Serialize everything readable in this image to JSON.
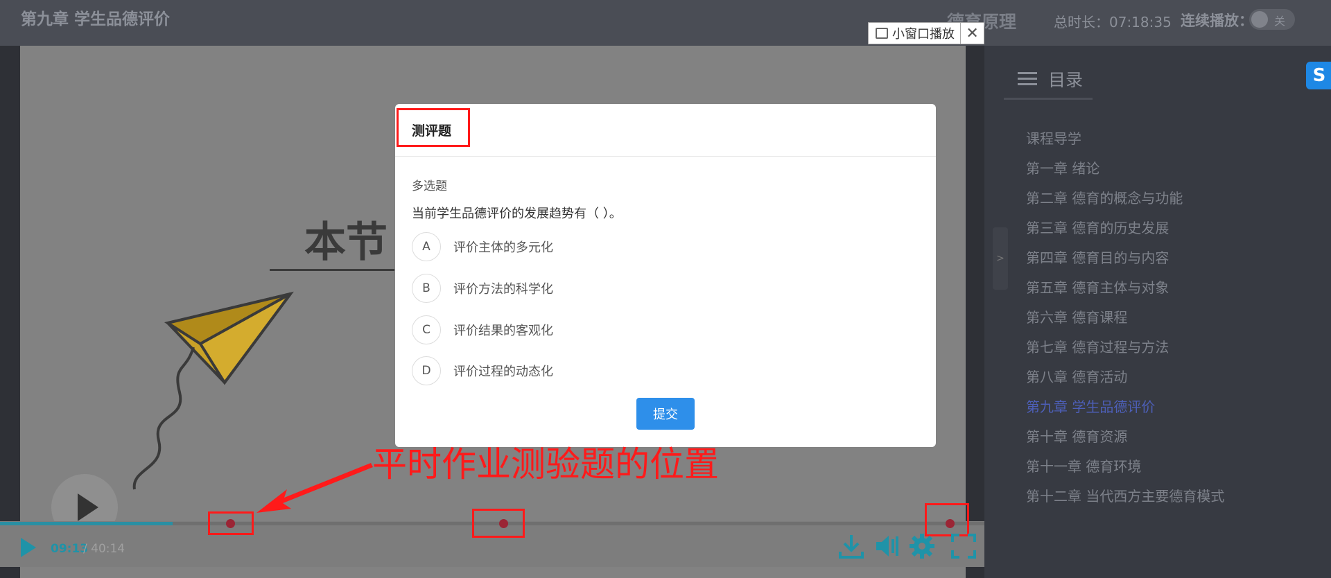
{
  "header": {
    "chapter_title": "第九章 学生品德评价",
    "course_name": "德育原理",
    "total_duration": "总时长：07:18:35",
    "autoplay_label": "连续播放：",
    "autoplay_state": "关"
  },
  "mini_window": {
    "label": "小窗口播放",
    "close": "✕"
  },
  "video": {
    "slide_text": "本节",
    "current_time": "09:13",
    "total_time": " / 40:14",
    "progress_percent": 17.5,
    "accent_color": "#1f93a8"
  },
  "quiz": {
    "title": "测评题",
    "question_type": "多选题",
    "question": "当前学生品德评价的发展趋势有（ ）。",
    "options": [
      {
        "letter": "A",
        "text": "评价主体的多元化"
      },
      {
        "letter": "B",
        "text": "评价方法的科学化"
      },
      {
        "letter": "C",
        "text": "评价结果的客观化"
      },
      {
        "letter": "D",
        "text": "评价过程的动态化"
      }
    ],
    "submit_label": "提交"
  },
  "annotation": {
    "text": "平时作业测验题的位置"
  },
  "sidebar": {
    "toc_label": "目录",
    "collapse_label": ">",
    "items": [
      "课程导学",
      "第一章 绪论",
      "第二章 德育的概念与功能",
      "第三章 德育的历史发展",
      "第四章 德育目的与内容",
      "第五章 德育主体与对象",
      "第六章 德育课程",
      "第七章 德育过程与方法",
      "第八章 德育活动",
      "第九章 学生品德评价",
      "第十章 德育资源",
      "第十一章 德育环境",
      "第十二章 当代西方主要德育模式"
    ],
    "active_index": 9
  },
  "extension_badge": "S"
}
